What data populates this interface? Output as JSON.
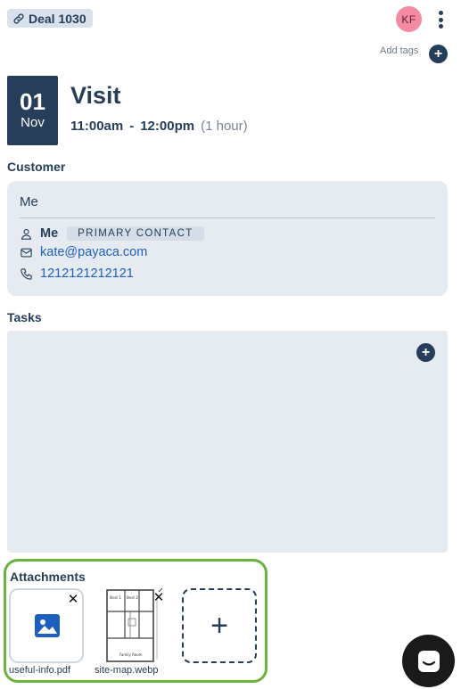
{
  "header": {
    "deal_label": "Deal 1030",
    "avatar_initials": "KF",
    "add_tags_label": "Add tags",
    "add_tags_plus": "+"
  },
  "event": {
    "day": "01",
    "month": "Nov",
    "title": "Visit",
    "start": "11:00am",
    "separator": "-",
    "end": "12:00pm",
    "duration": "(1 hour)"
  },
  "customer": {
    "heading": "Customer",
    "name": "Me",
    "contact_name": "Me",
    "contact_tag": "PRIMARY CONTACT",
    "email": "kate@payaca.com",
    "phone": "1212121212121"
  },
  "tasks": {
    "heading": "Tasks",
    "add_plus": "+"
  },
  "attachments": {
    "heading": "Attachments",
    "files": [
      {
        "name": "useful-info.pdf",
        "icon": "image-icon"
      },
      {
        "name": "site-map.webp",
        "icon": "floor-plan-thumbnail"
      }
    ],
    "remove_symbol": "✕",
    "add_symbol": "+"
  },
  "colors": {
    "brand_navy": "#263e59",
    "card_bg": "#e6ebf2",
    "link_blue": "#1f5fbf",
    "highlight_green": "#6bb33f",
    "avatar_pink": "#f58aa3"
  }
}
